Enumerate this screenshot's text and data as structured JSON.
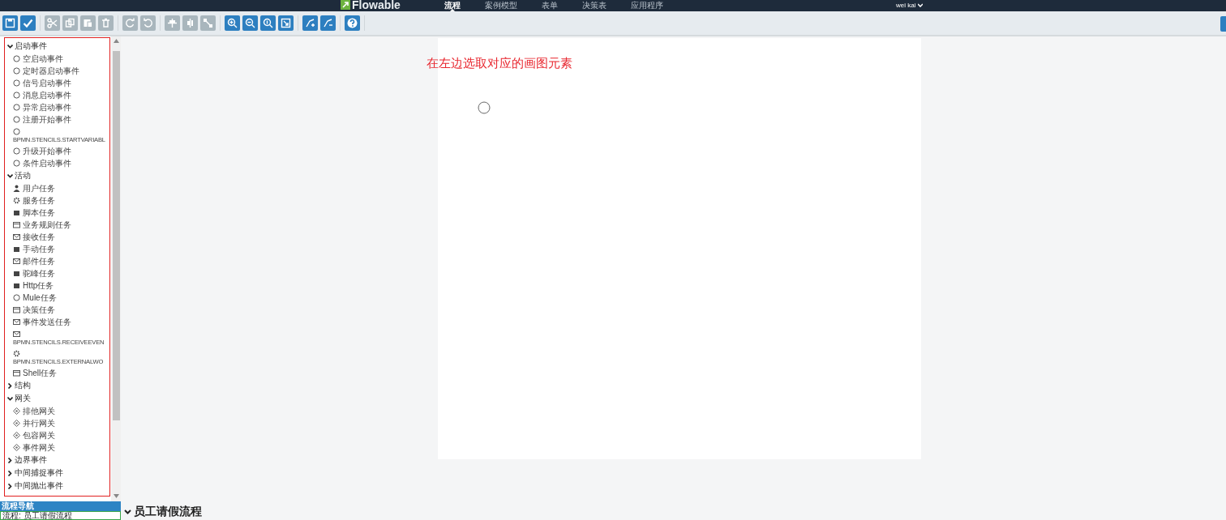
{
  "navbar": {
    "logo": "Flowable",
    "tabs": [
      {
        "label": "流程",
        "selected": true
      },
      {
        "label": "案例模型",
        "selected": false
      },
      {
        "label": "表单",
        "selected": false
      },
      {
        "label": "决策表",
        "selected": false
      },
      {
        "label": "应用程序",
        "selected": false
      }
    ],
    "user": "wei kai"
  },
  "toolbar": {
    "groups": [
      [
        {
          "disabled": false
        },
        {
          "disabled": false
        }
      ],
      [
        {
          "disabled": true
        },
        {
          "disabled": true
        },
        {
          "disabled": true
        },
        {
          "disabled": true
        }
      ],
      [
        {
          "disabled": true
        },
        {
          "disabled": true
        }
      ],
      [
        {
          "disabled": true
        },
        {
          "disabled": true
        },
        {
          "disabled": true
        }
      ],
      [
        {
          "disabled": false
        },
        {
          "disabled": false
        },
        {
          "disabled": false
        },
        {
          "disabled": false
        }
      ],
      [
        {
          "disabled": false
        },
        {
          "disabled": false
        }
      ],
      [
        {
          "disabled": false
        }
      ]
    ]
  },
  "palette": {
    "groups": [
      {
        "label": "启动事件",
        "expanded": true,
        "items": [
          {
            "label": "空启动事件",
            "kind": "event"
          },
          {
            "label": "定时器启动事件",
            "kind": "event"
          },
          {
            "label": "信号启动事件",
            "kind": "event"
          },
          {
            "label": "消息启动事件",
            "kind": "event"
          },
          {
            "label": "异常启动事件",
            "kind": "event"
          },
          {
            "label": "注册开始事件",
            "kind": "event"
          },
          {
            "label": "BPMN.STENCILS.STARTVARIABL",
            "kind": "event"
          },
          {
            "label": "升级开始事件",
            "kind": "event"
          },
          {
            "label": "条件启动事件",
            "kind": "event"
          }
        ]
      },
      {
        "label": "活动",
        "expanded": true,
        "items": [
          {
            "label": "用户任务",
            "kind": "user"
          },
          {
            "label": "服务任务",
            "kind": "gear"
          },
          {
            "label": "脚本任务",
            "kind": "task"
          },
          {
            "label": "业务规则任务",
            "kind": "table"
          },
          {
            "label": "接收任务",
            "kind": "envelope"
          },
          {
            "label": "手动任务",
            "kind": "task"
          },
          {
            "label": "邮件任务",
            "kind": "envelope"
          },
          {
            "label": "驼峰任务",
            "kind": "task"
          },
          {
            "label": "Http任务",
            "kind": "task"
          },
          {
            "label": "Mule任务",
            "kind": "event"
          },
          {
            "label": "决策任务",
            "kind": "table"
          },
          {
            "label": "事件发送任务",
            "kind": "envelope"
          },
          {
            "label": "BPMN.STENCILS.RECEIVEEVEN",
            "kind": "envelope"
          },
          {
            "label": "BPMN.STENCILS.EXTERNALWO",
            "kind": "gear"
          },
          {
            "label": "Shell任务",
            "kind": "table"
          }
        ]
      },
      {
        "label": "结构",
        "expanded": false
      },
      {
        "label": "网关",
        "expanded": true,
        "items": [
          {
            "label": "排他网关",
            "kind": "gateway"
          },
          {
            "label": "并行网关",
            "kind": "gateway"
          },
          {
            "label": "包容网关",
            "kind": "gateway"
          },
          {
            "label": "事件网关",
            "kind": "gateway"
          }
        ]
      },
      {
        "label": "边界事件",
        "expanded": false
      },
      {
        "label": "中间捕捉事件",
        "expanded": false
      },
      {
        "label": "中间抛出事件",
        "expanded": false
      }
    ]
  },
  "annotation": "在左边选取对应的画图元素",
  "navigator": {
    "title": "流程导航",
    "text": "流程: 员工请假流程"
  },
  "process_title": "员工请假流程"
}
